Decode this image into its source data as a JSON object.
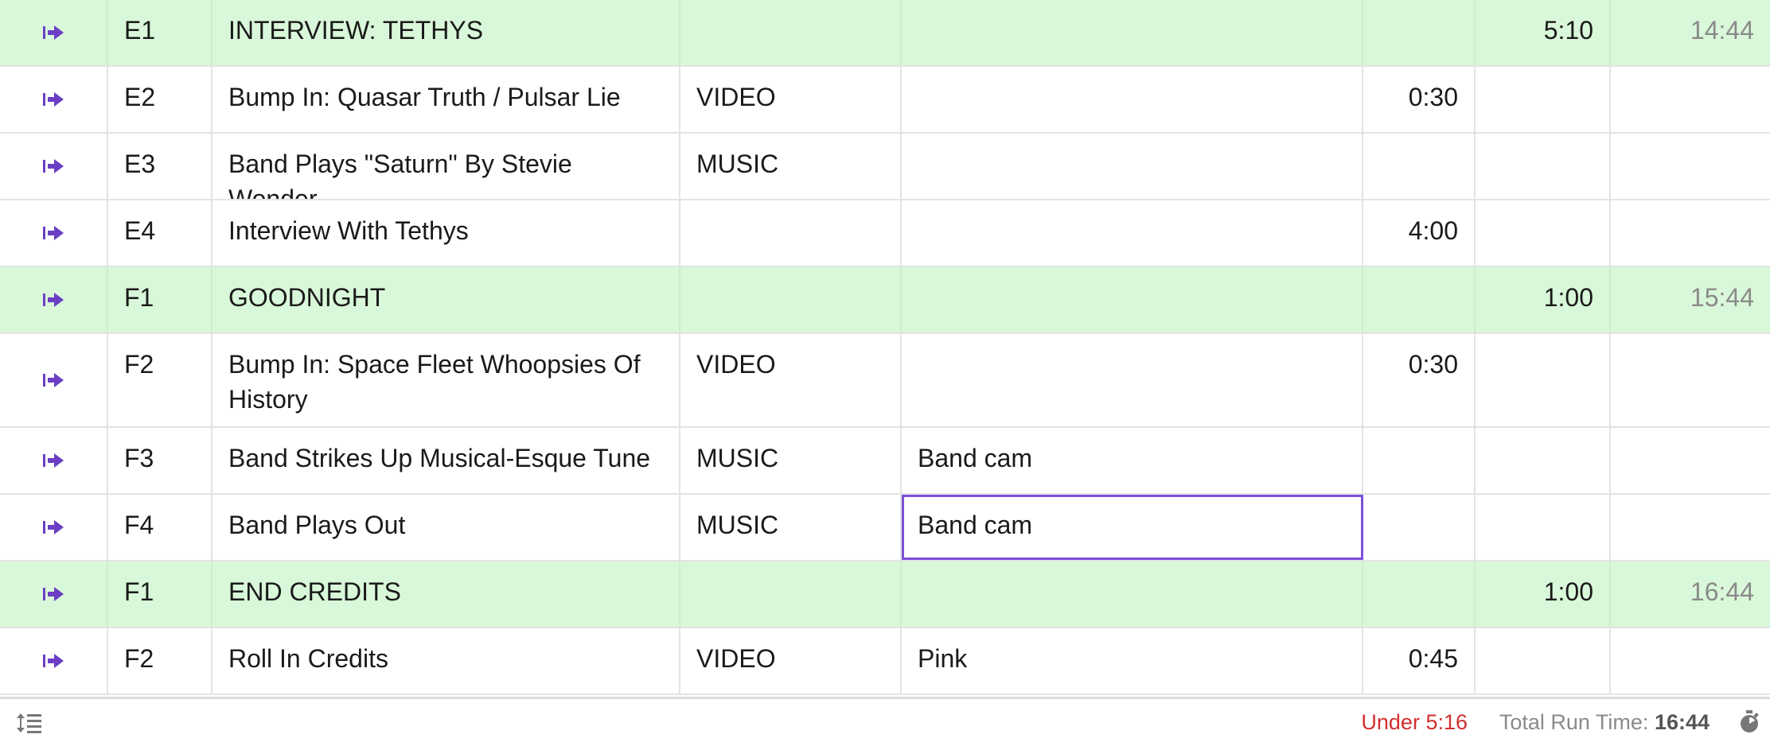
{
  "colors": {
    "segment_bg": "#d9f7d9",
    "accent": "#7b4fd6",
    "under": "#d32f2f",
    "muted": "#8a8a8a"
  },
  "rows": [
    {
      "kind": "segment",
      "num": "E1",
      "title": "INTERVIEW: TETHYS",
      "type": "",
      "notes": "",
      "duration": "",
      "segment_time": "5:10",
      "clock": "14:44"
    },
    {
      "kind": "item",
      "num": "E2",
      "title": "Bump In: Quasar Truth / Pulsar Lie",
      "type": "VIDEO",
      "notes": "",
      "duration": "0:30",
      "segment_time": "",
      "clock": ""
    },
    {
      "kind": "item",
      "num": "E3",
      "title": "Band Plays \"Saturn\" By Stevie Wonder",
      "type": "MUSIC",
      "notes": "",
      "duration": "",
      "segment_time": "",
      "clock": ""
    },
    {
      "kind": "item",
      "num": "E4",
      "title": "Interview With Tethys",
      "type": "",
      "notes": "",
      "duration": "4:00",
      "segment_time": "",
      "clock": ""
    },
    {
      "kind": "segment",
      "num": "F1",
      "title": "GOODNIGHT",
      "type": "",
      "notes": "",
      "duration": "",
      "segment_time": "1:00",
      "clock": "15:44"
    },
    {
      "kind": "item",
      "num": "F2",
      "title": "Bump In: Space Fleet Whoopsies Of History",
      "type": "VIDEO",
      "notes": "",
      "duration": "0:30",
      "segment_time": "",
      "clock": "",
      "tall": true
    },
    {
      "kind": "item",
      "num": "F3",
      "title": "Band Strikes Up Musical-Esque Tune",
      "type": "MUSIC",
      "notes": "Band cam",
      "duration": "",
      "segment_time": "",
      "clock": ""
    },
    {
      "kind": "item",
      "num": "F4",
      "title": "Band Plays Out",
      "type": "MUSIC",
      "notes": "Band cam",
      "duration": "",
      "segment_time": "",
      "clock": "",
      "selected_notes": true
    },
    {
      "kind": "segment",
      "num": "F1",
      "title": "END CREDITS",
      "type": "",
      "notes": "",
      "duration": "",
      "segment_time": "1:00",
      "clock": "16:44"
    },
    {
      "kind": "item",
      "num": "F2",
      "title": "Roll In Credits",
      "type": "VIDEO",
      "notes": "Pink",
      "duration": "0:45",
      "segment_time": "",
      "clock": ""
    }
  ],
  "footer": {
    "status": "Under 5:16",
    "total_label": "Total Run Time:",
    "total_value": "16:44",
    "left_icon": "line-height-icon",
    "right_icon": "stopwatch-icon"
  },
  "icons": {
    "row_icon": "go-to-arrow-icon"
  }
}
